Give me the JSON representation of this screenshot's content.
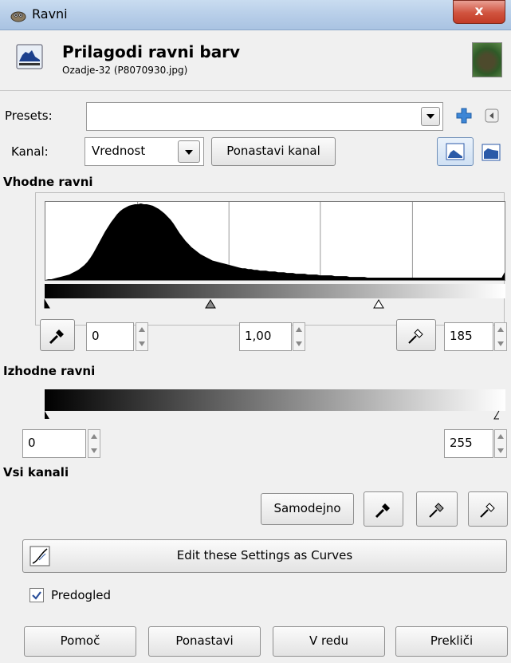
{
  "window": {
    "title": "Ravni",
    "close_label": "x"
  },
  "header": {
    "title": "Prilagodi ravni barv",
    "subtitle": "Ozadje-32 (P8070930.jpg)"
  },
  "presets": {
    "label": "Presets:",
    "value": ""
  },
  "channel": {
    "label": "Kanal:",
    "value": "Vrednost",
    "reset_label": "Ponastavi kanal"
  },
  "input_levels": {
    "heading": "Vhodne ravni",
    "low": "0",
    "gamma": "1,00",
    "high": "185",
    "histogram": [
      0,
      1,
      1,
      2,
      3,
      4,
      5,
      6,
      7,
      9,
      11,
      13,
      16,
      19,
      23,
      28,
      34,
      41,
      48,
      55,
      62,
      68,
      74,
      79,
      84,
      88,
      91,
      93,
      95,
      96,
      97,
      97,
      98,
      97,
      97,
      96,
      95,
      93,
      91,
      88,
      85,
      81,
      77,
      72,
      66,
      60,
      55,
      50,
      46,
      42,
      39,
      36,
      33,
      31,
      29,
      27,
      25,
      24,
      23,
      22,
      21,
      20,
      19,
      18,
      17,
      16,
      15,
      15,
      14,
      14,
      13,
      13,
      12,
      12,
      12,
      11,
      11,
      11,
      10,
      10,
      10,
      9,
      9,
      9,
      8,
      8,
      8,
      8,
      7,
      7,
      7,
      7,
      6,
      6,
      6,
      6,
      6,
      5,
      5,
      5,
      5,
      5,
      4,
      4,
      4,
      4,
      4,
      4,
      3,
      3,
      3,
      3,
      3,
      3,
      3,
      3,
      3,
      3,
      3,
      3,
      3,
      3,
      3,
      3,
      3,
      3,
      3,
      3,
      3,
      3,
      3,
      3,
      3,
      3,
      3,
      3,
      3,
      3,
      3,
      3,
      3,
      3,
      3,
      3,
      3,
      3,
      3,
      3,
      3,
      3,
      3,
      3,
      3,
      3,
      10
    ]
  },
  "output_levels": {
    "heading": "Izhodne ravni",
    "low": "0",
    "high": "255"
  },
  "all_channels": {
    "heading": "Vsi kanali",
    "auto_label": "Samodejno"
  },
  "curves_button": {
    "label": "Edit these Settings as Curves"
  },
  "preview": {
    "label": "Predogled",
    "checked": true
  },
  "footer": {
    "help": "Pomoč",
    "reset": "Ponastavi",
    "ok": "V redu",
    "cancel": "Prekliči"
  },
  "colors": {
    "accent": "#3a7bd5",
    "add": "#3d86d6"
  }
}
